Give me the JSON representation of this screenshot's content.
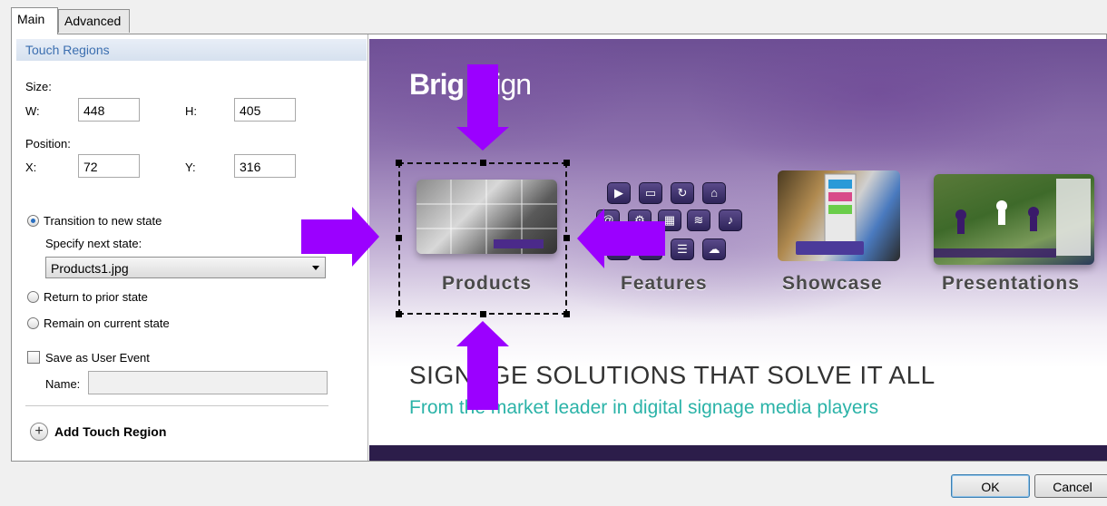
{
  "tabs": [
    {
      "label": "Main",
      "active": true
    },
    {
      "label": "Advanced",
      "active": false
    }
  ],
  "touch_regions": {
    "header": "Touch Regions",
    "size_label": "Size:",
    "w_label": "W:",
    "w_value": "448",
    "h_label": "H:",
    "h_value": "405",
    "position_label": "Position:",
    "x_label": "X:",
    "x_value": "72",
    "y_label": "Y:",
    "y_value": "316"
  },
  "state_options": {
    "transition_label": "Transition to new state",
    "specify_label": "Specify next state:",
    "next_state_value": "Products1.jpg",
    "return_label": "Return to prior state",
    "remain_label": "Remain on current state",
    "selected": "transition"
  },
  "user_event": {
    "checkbox_label": "Save as User Event",
    "checked": false,
    "name_label": "Name:",
    "name_value": ""
  },
  "add_touch_region_label": "Add Touch Region",
  "preview": {
    "logo_part1": "Brig",
    "logo_part2": "Sign",
    "tiles": [
      "Products",
      "Features",
      "Showcase",
      "Presentations"
    ],
    "headline": "SIGNAGE SOLUTIONS THAT SOLVE IT ALL",
    "subline": "From the market leader in digital signage media players"
  },
  "annotation_color": "#9b00ff",
  "buttons": {
    "ok": "OK",
    "cancel": "Cancel"
  }
}
